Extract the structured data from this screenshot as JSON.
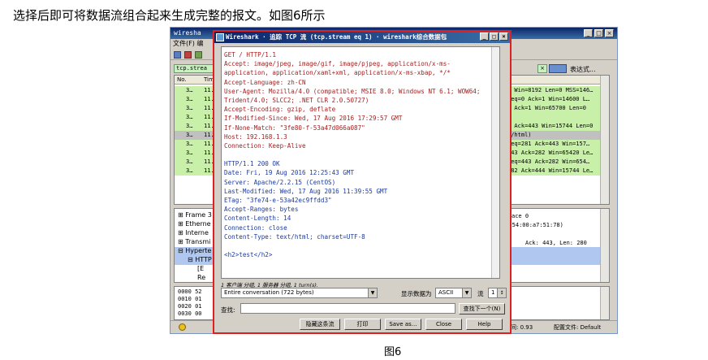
{
  "caption": "选择后即可将数据流组合起来生成完整的报文。如图6所示",
  "figure_label": "图6",
  "main_window": {
    "title": "wiresha",
    "menu": "文件(F)  编",
    "filter_value": "tcp.strea",
    "expression_label": "表达式...",
    "col_no": "No.",
    "col_time": "Tim",
    "rows": [
      {
        "num": "3…",
        "time": "11.",
        "info": "0 Win=8192 Len=0 MSS=146…",
        "color": "#c8f0a8"
      },
      {
        "num": "3…",
        "time": "11.",
        "info": "Seq=0 Ack=1 Win=14600 L…",
        "color": "#c8f0a8"
      },
      {
        "num": "3…",
        "time": "11.",
        "info": "1 Ack=1 Win=65700 Len=0",
        "color": "#c8f0a8"
      },
      {
        "num": "3…",
        "time": "11.",
        "info": "",
        "color": "#c8f0a8"
      },
      {
        "num": "3…",
        "time": "11.",
        "info": "1 Ack=443 Win=15744 Len=0",
        "color": "#c8f0a8"
      },
      {
        "num": "3…",
        "time": "11.",
        "info": "t/html)",
        "color": "#c8f0a8"
      },
      {
        "num": "3…",
        "time": "11.",
        "info": "Seq=281 Ack=443 Win=157…",
        "color": "#c8f0a8"
      },
      {
        "num": "3…",
        "time": "11.",
        "info": "443 Ack=282 Win=65420 Le…",
        "color": "#c8f0a8"
      },
      {
        "num": "3…",
        "time": "11.",
        "info": "Seq=443 Ack=282 Win=654…",
        "color": "#c8f0a8"
      },
      {
        "num": "3…",
        "time": "11.",
        "info": "282 Ack=444 Win=15744 Le…",
        "color": "#c8f0a8"
      }
    ],
    "tree": [
      {
        "label": "Frame 3"
      },
      {
        "label": "Etherne"
      },
      {
        "label": "Interne"
      },
      {
        "label": "Transmi"
      },
      {
        "label": "Hyperte"
      },
      {
        "label": "HTTP"
      },
      {
        "label": "[E"
      },
      {
        "label": "Re"
      }
    ],
    "tree_info": [
      "ace 0",
      ":2:54:00:a7:51:78)",
      "Ack: 443, Len: 280"
    ],
    "hex_rows": [
      "0000  52",
      "0010  01",
      "0020  01",
      "0030  00"
    ],
    "status_time": "时间: 0.93",
    "status_profile": "配置文件: Default"
  },
  "dialog": {
    "title": "Wireshark · 追踪 TCP 流 (tcp.stream eq 1) · wireshark综合数据包",
    "request": [
      "GET / HTTP/1.1",
      "Accept: image/jpeg, image/gif, image/pjpeg, application/x-ms-",
      "application, application/xaml+xml, application/x-ms-xbap, */*",
      "Accept-Language: zh-CN",
      "User-Agent: Mozilla/4.0 (compatible; MSIE 8.0; Windows NT 6.1; WOW64;",
      "Trident/4.0; SLCC2; .NET CLR 2.0.50727)",
      "Accept-Encoding: gzip, deflate",
      "If-Modified-Since: Wed, 17 Aug 2016 17:29:57 GMT",
      "If-None-Match: \"3fe80-f-53a47d066a087\"",
      "Host: 192.168.1.3",
      "Connection: Keep-Alive"
    ],
    "response": [
      "HTTP/1.1 200 OK",
      "Date: Fri, 19 Aug 2016 12:25:43 GMT",
      "Server: Apache/2.2.15 (CentOS)",
      "Last-Modified: Wed, 17 Aug 2016 11:39:55 GMT",
      "ETag: \"3fe74-e-53a42ec9ffdd3\"",
      "Accept-Ranges: bytes",
      "Content-Length: 14",
      "Connection: close",
      "Content-Type: text/html; charset=UTF-8"
    ],
    "body_line": "<h2>test</h2>",
    "info": "1 客户端 分组, 1 服务器 分组, 1 turn(s).",
    "conversation": "Entire conversation (722 bytes)",
    "show_label": "显示数据为",
    "show_value": "ASCII",
    "flow_label": "流",
    "flow_value": "1",
    "find_label": "查找:",
    "find_next": "查找下一个(N)",
    "buttons": {
      "hide": "隐藏这条流",
      "print": "打印",
      "save_as": "Save as…",
      "close": "Close",
      "help": "Help"
    },
    "colors": {
      "request": "#a52020",
      "response": "#1a3aa0",
      "border": "#e02020"
    }
  }
}
